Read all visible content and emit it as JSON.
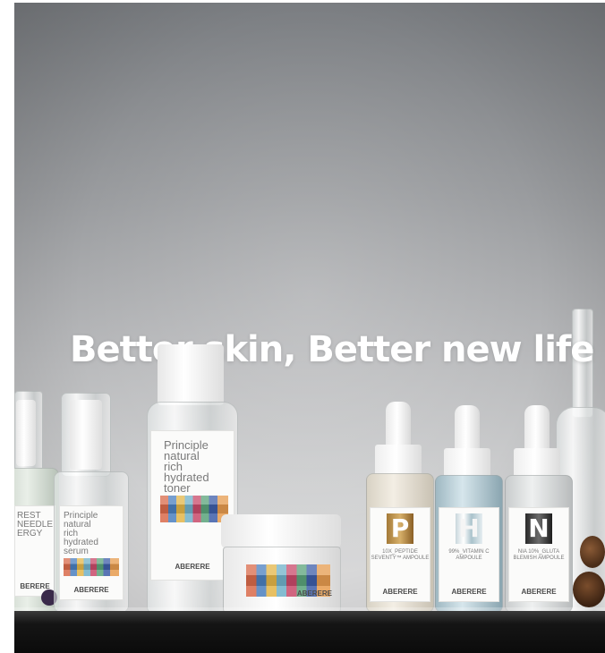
{
  "banner": {
    "headline": "Better skin, Better new life"
  },
  "products": {
    "serum_left": {
      "label": [
        "REST",
        "NEEDLE",
        "ERGY"
      ],
      "brand": "BERERE"
    },
    "serum_pump": {
      "label": [
        "Principle",
        "natural",
        "rich",
        "hydrated",
        "serum"
      ],
      "brand": "ABERERE"
    },
    "toner": {
      "label": [
        "Principle",
        "natural",
        "rich",
        "hydrated",
        "toner"
      ],
      "brand": "ABERERE"
    },
    "cream_jar": {
      "brand": "ABERERE"
    },
    "ampoule_p": {
      "letter": "P",
      "name": [
        "10X_PEPTIDE",
        "SEVENTY™ AMPOULE"
      ],
      "brand": "ABERERE"
    },
    "ampoule_h": {
      "letter": "H",
      "name": [
        "99%_VITAMIN C",
        "AMPOULE"
      ],
      "brand": "ABERERE"
    },
    "ampoule_n": {
      "letter": "N",
      "name": [
        "NIA 10%_GLUTA",
        "BLEMISH AMPOULE"
      ],
      "brand": "ABERERE"
    }
  },
  "colors": {
    "background_top": "#7b7e82",
    "background_bottom": "#d8d8d9",
    "shelf": "#0b0b0b",
    "headline": "#ffffff"
  }
}
